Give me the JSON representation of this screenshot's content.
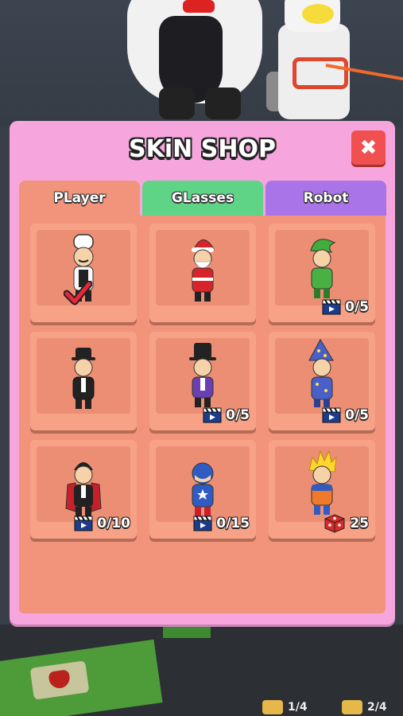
{
  "panel": {
    "title": "SKiN SHOP",
    "close_label": "✖"
  },
  "tabs": [
    {
      "label": "PLayer",
      "color": "#f2937b",
      "selected": true
    },
    {
      "label": "GLasses",
      "color": "#5fd487",
      "selected": false
    },
    {
      "label": "Robot",
      "color": "#a874e8",
      "selected": false
    }
  ],
  "skins": [
    {
      "name": "chef",
      "progress": "",
      "icon": "checkmark-icon",
      "selected": true
    },
    {
      "name": "santa",
      "progress": "",
      "icon": "",
      "selected": false
    },
    {
      "name": "elf",
      "progress": "0/5",
      "icon": "video-ad-icon",
      "selected": false
    },
    {
      "name": "gentleman",
      "progress": "",
      "icon": "",
      "selected": false
    },
    {
      "name": "magician",
      "progress": "0/5",
      "icon": "video-ad-icon",
      "selected": false
    },
    {
      "name": "wizard",
      "progress": "0/5",
      "icon": "video-ad-icon",
      "selected": false
    },
    {
      "name": "vampire",
      "progress": "0/10",
      "icon": "video-ad-icon",
      "selected": false
    },
    {
      "name": "captain",
      "progress": "0/15",
      "icon": "video-ad-icon",
      "selected": false
    },
    {
      "name": "super-saiyan",
      "progress": "25",
      "icon": "gift-cube-icon",
      "selected": false
    }
  ],
  "background": {
    "counter_left": "1/4",
    "counter_right": "2/4"
  },
  "colors": {
    "panel": "#f6a6dc",
    "tab_player": "#f2937b",
    "tab_glasses": "#5fd487",
    "tab_robot": "#a874e8",
    "close": "#f0504f"
  }
}
